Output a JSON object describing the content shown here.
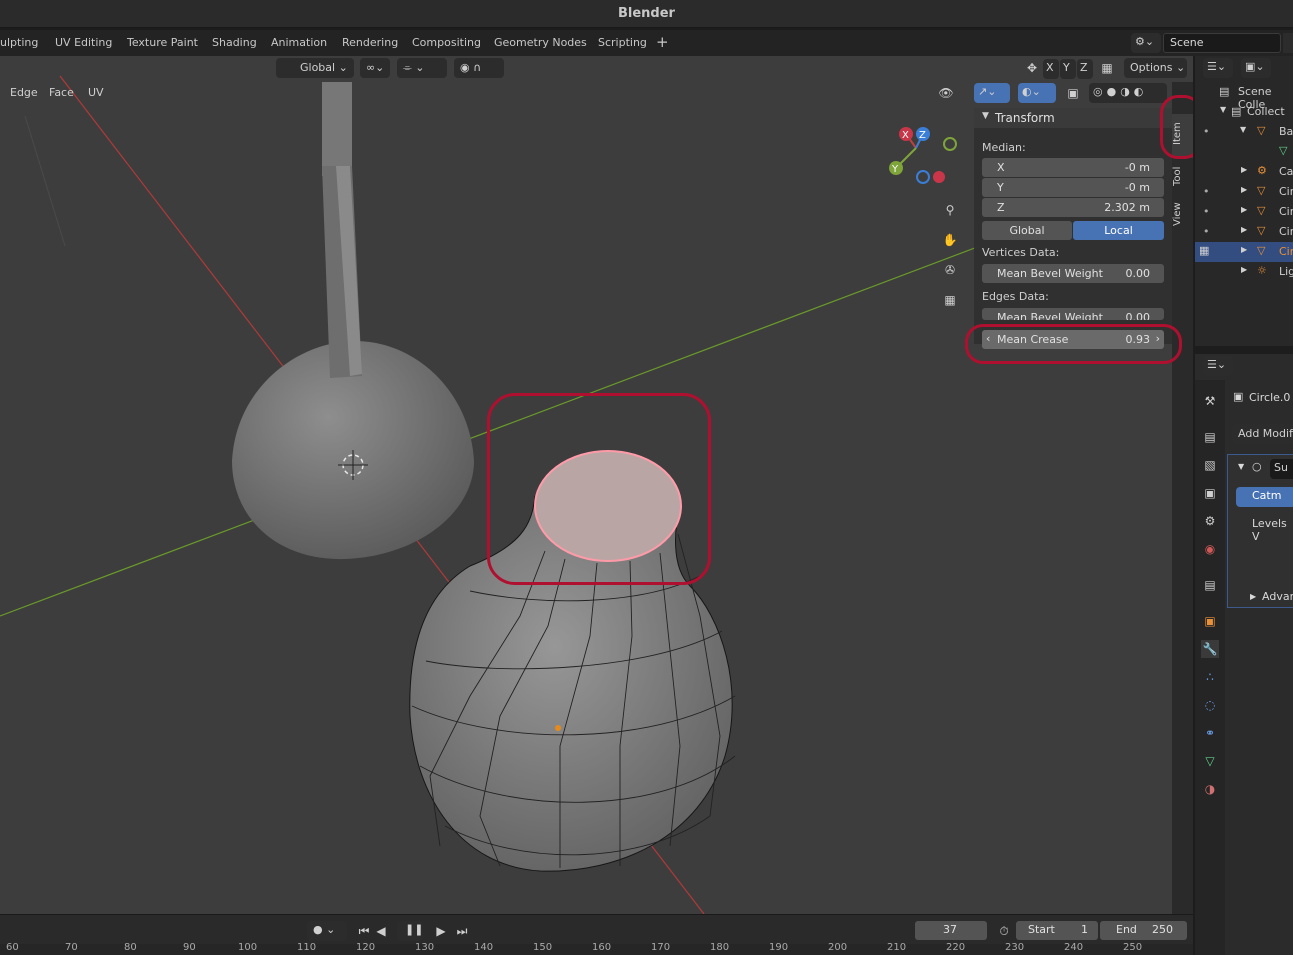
{
  "app": {
    "title": "Blender"
  },
  "workspace_tabs": [
    "ulpting",
    "UV Editing",
    "Texture Paint",
    "Shading",
    "Animation",
    "Rendering",
    "Compositing",
    "Geometry Nodes",
    "Scripting"
  ],
  "scene": {
    "label": "Scene"
  },
  "viewport_header": {
    "transform_orientation": "Global",
    "axes": [
      "X",
      "Y",
      "Z"
    ],
    "options_label": "Options",
    "select_menus": [
      "Edge",
      "Face",
      "UV"
    ]
  },
  "npanel": {
    "section_title": "Transform",
    "median_label": "Median:",
    "median": [
      {
        "axis": "X",
        "value": "-0 m"
      },
      {
        "axis": "Y",
        "value": "-0 m"
      },
      {
        "axis": "Z",
        "value": "2.302 m"
      }
    ],
    "space_global": "Global",
    "space_local": "Local",
    "vertices_label": "Vertices Data:",
    "vertex_bevel": {
      "label": "Mean Bevel Weight",
      "value": "0.00"
    },
    "edges_label": "Edges Data:",
    "edge_bevel": {
      "label": "Mean Bevel Weight",
      "value": "0.00"
    },
    "crease": {
      "label": "Mean Crease",
      "value": "0.93"
    },
    "tabs": [
      "Item",
      "Tool",
      "View"
    ]
  },
  "gizmo": {
    "x": "X",
    "y": "Y",
    "z": "Z"
  },
  "timeline": {
    "current_frame": "37",
    "start_label": "Start",
    "start": "1",
    "end_label": "End",
    "end": "250",
    "ruler": [
      "60",
      "70",
      "80",
      "90",
      "100",
      "110",
      "120",
      "130",
      "140",
      "150",
      "160",
      "170",
      "180",
      "190",
      "200",
      "210",
      "220",
      "230",
      "240",
      "250"
    ]
  },
  "outliner": {
    "scene_collection": "Scene Colle",
    "collection": "Collect",
    "items": [
      "Ba",
      "Ca",
      "Cir",
      "Cir",
      "Cir",
      "Cir",
      "Lig"
    ]
  },
  "properties": {
    "object_name": "Circle.0",
    "add_modifier": "Add Modifi",
    "modifier_name": "Su",
    "catmull": "Catm",
    "levels": "Levels V",
    "advanced": "Advan"
  },
  "colors": {
    "accent": "#4772b3",
    "annotation": "#b0102f",
    "viewport": "#3d3d3d"
  }
}
